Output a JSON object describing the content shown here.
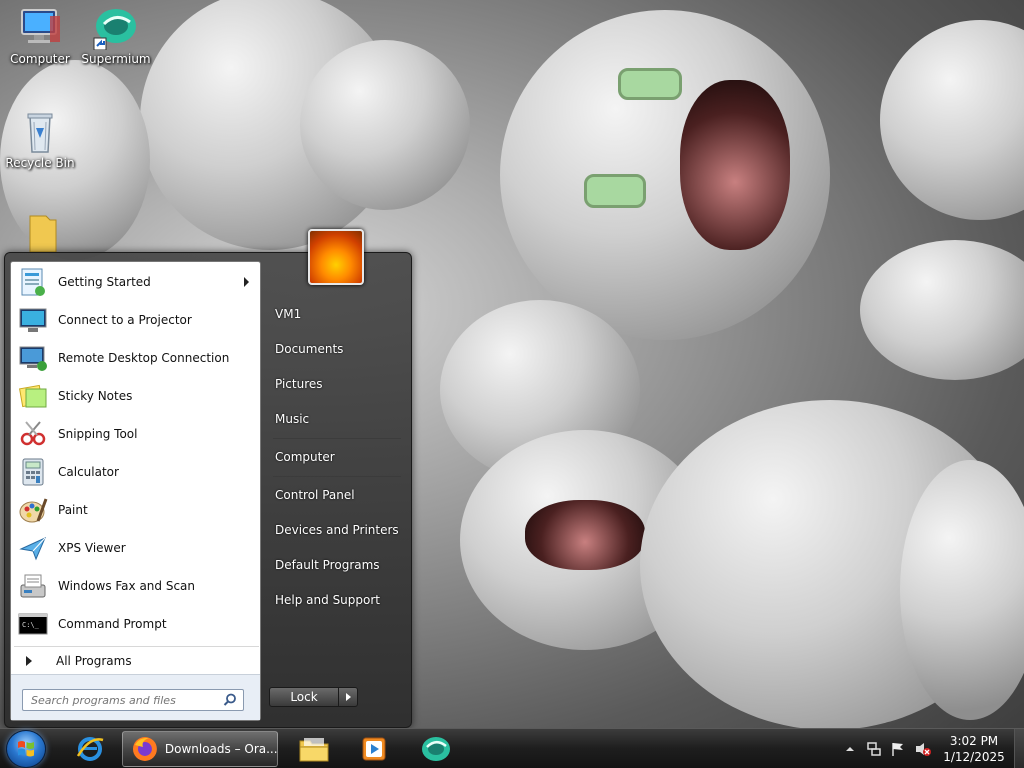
{
  "desktop": {
    "icons": [
      {
        "label": "Computer",
        "icon": "computer-icon"
      },
      {
        "label": "Supermium",
        "icon": "supermium-icon"
      },
      {
        "label": "Recycle Bin",
        "icon": "recycle-bin-icon"
      }
    ]
  },
  "start_menu": {
    "programs": [
      {
        "label": "Getting Started",
        "icon": "getting-started-icon",
        "has_submenu": true
      },
      {
        "label": "Connect to a Projector",
        "icon": "projector-icon"
      },
      {
        "label": "Remote Desktop Connection",
        "icon": "remote-desktop-icon"
      },
      {
        "label": "Sticky Notes",
        "icon": "sticky-notes-icon"
      },
      {
        "label": "Snipping Tool",
        "icon": "snipping-tool-icon"
      },
      {
        "label": "Calculator",
        "icon": "calculator-icon"
      },
      {
        "label": "Paint",
        "icon": "paint-icon"
      },
      {
        "label": "XPS Viewer",
        "icon": "xps-viewer-icon"
      },
      {
        "label": "Windows Fax and Scan",
        "icon": "fax-scan-icon"
      },
      {
        "label": "Command Prompt",
        "icon": "command-prompt-icon"
      }
    ],
    "all_programs": "All Programs",
    "search_placeholder": "Search programs and files",
    "right_items": [
      {
        "label": "VM1"
      },
      {
        "label": "Documents"
      },
      {
        "label": "Pictures"
      },
      {
        "label": "Music"
      },
      {
        "label": "Computer"
      },
      {
        "label": "Control Panel"
      },
      {
        "label": "Devices and Printers"
      },
      {
        "label": "Default Programs"
      },
      {
        "label": "Help and Support"
      }
    ],
    "lock_label": "Lock"
  },
  "taskbar": {
    "active_window": "Downloads – Ora...",
    "pinned": [
      "internet-explorer-icon",
      "firefox-icon",
      "file-explorer-icon",
      "media-player-icon",
      "supermium-icon"
    ],
    "clock_time": "3:02 PM",
    "clock_date": "1/12/2025",
    "tray_icons": [
      "show-hidden-icons",
      "network-icon",
      "action-center-flag-icon",
      "volume-muted-icon"
    ]
  }
}
